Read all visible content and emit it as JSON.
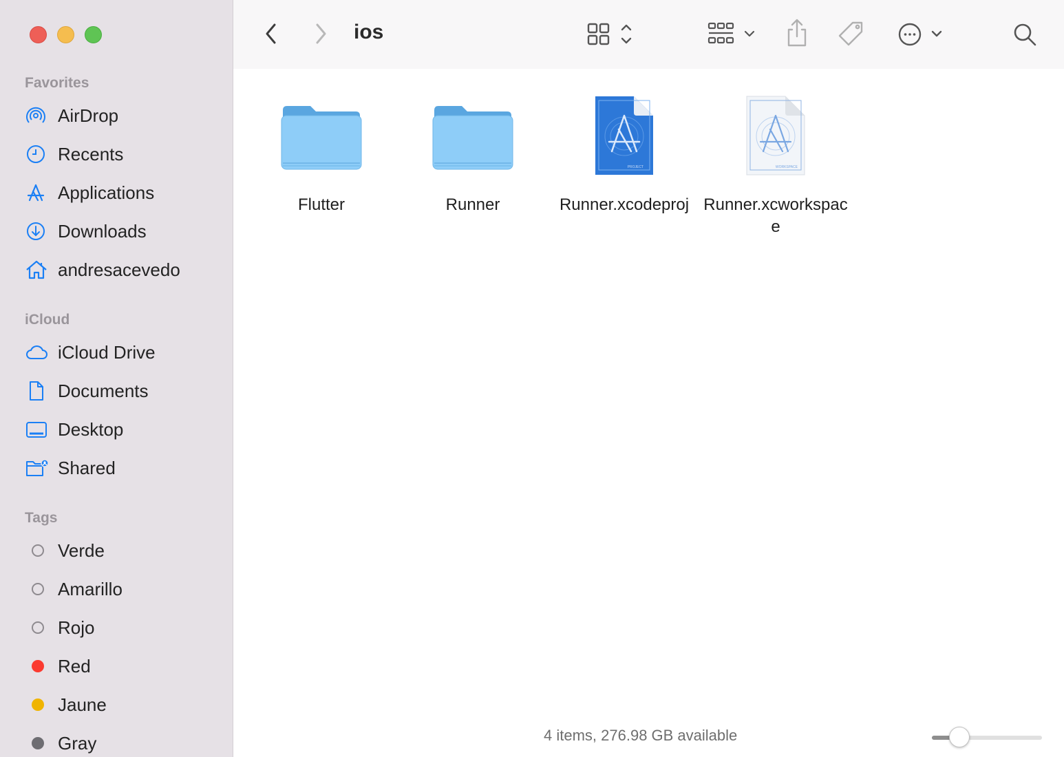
{
  "window": {
    "title": "ios"
  },
  "sidebar": {
    "sections": {
      "favorites": "Favorites",
      "icloud": "iCloud",
      "tags": "Tags"
    },
    "favorites": [
      {
        "label": "AirDrop",
        "icon": "airdrop-icon"
      },
      {
        "label": "Recents",
        "icon": "clock-icon"
      },
      {
        "label": "Applications",
        "icon": "applications-icon"
      },
      {
        "label": "Downloads",
        "icon": "download-icon"
      },
      {
        "label": "andresacevedo",
        "icon": "home-icon"
      }
    ],
    "icloud": [
      {
        "label": "iCloud Drive",
        "icon": "cloud-icon"
      },
      {
        "label": "Documents",
        "icon": "document-icon"
      },
      {
        "label": "Desktop",
        "icon": "desktop-icon"
      },
      {
        "label": "Shared",
        "icon": "shared-folder-icon"
      }
    ],
    "tags": [
      {
        "label": "Verde",
        "color": "none"
      },
      {
        "label": "Amarillo",
        "color": "none"
      },
      {
        "label": "Rojo",
        "color": "none"
      },
      {
        "label": "Red",
        "color": "#fb3a30"
      },
      {
        "label": "Jaune",
        "color": "#f0b400"
      },
      {
        "label": "Gray",
        "color": "#6e6d72"
      }
    ]
  },
  "toolbar": {
    "back_icon": "chevron-left-icon",
    "forward_icon": "chevron-right-icon",
    "view_icon": "grid-view-icon",
    "group_icon": "group-icon",
    "share_icon": "share-icon",
    "tag_icon": "tag-icon",
    "more_icon": "ellipsis-circle-icon",
    "search_icon": "search-icon"
  },
  "files": [
    {
      "name": "Flutter",
      "kind": "folder"
    },
    {
      "name": "Runner",
      "kind": "folder"
    },
    {
      "name": "Runner.xcodeproj",
      "kind": "xcodeproj",
      "badge": "PROJECT"
    },
    {
      "name": "Runner.xcworkspace",
      "kind": "xcworkspace",
      "badge": "WORKSPACE"
    }
  ],
  "status": {
    "text": "4 items, 276.98 GB available",
    "icon_size_level": 0.25
  },
  "colors": {
    "accent": "#1a7ff5",
    "sidebar_bg": "#e6e1e6",
    "folder": "#7fc4f5"
  }
}
